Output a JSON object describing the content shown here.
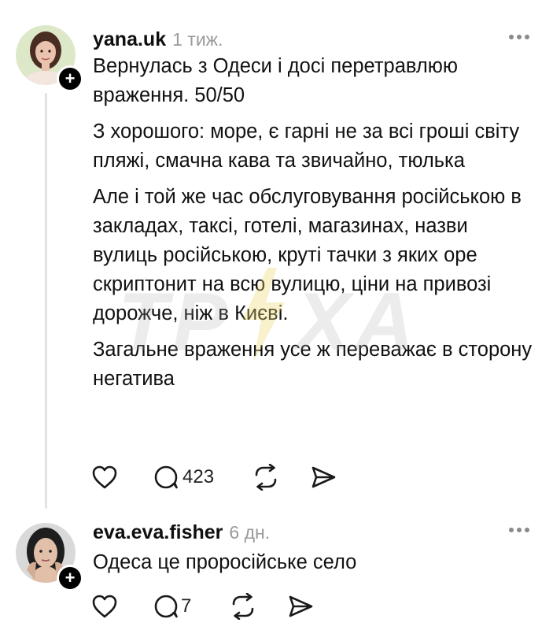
{
  "watermark": {
    "left": "ТР",
    "right": "ХА"
  },
  "posts": [
    {
      "username": "yana.uk",
      "time": "1 тиж.",
      "paragraphs": [
        "Вернулась з Одеси і досі перетравлюю враження. 50/50",
        "З хорошого: море, є гарні не за всі гроші світу пляжі, смачна кава та звичайно, тюлька",
        "Але і той же час обслуговування російською в закладах, таксі, готелі, магазинах, назви вулиць російською, круті тачки з яких оре скриптонит на всю вулицю, ціни на привозі дорожче, ніж в Києві.",
        "Загальне враження усе ж переважає в сторону негатива"
      ],
      "reply_count": "423"
    },
    {
      "username": "eva.eva.fisher",
      "time": "6 дн.",
      "paragraphs": [
        "Одеса це проросійське село"
      ],
      "reply_count": "7"
    }
  ],
  "badge_symbol": "+",
  "icons": [
    "more-icon",
    "heart-icon",
    "reply-icon",
    "repost-icon",
    "share-icon",
    "follow-plus-icon"
  ]
}
